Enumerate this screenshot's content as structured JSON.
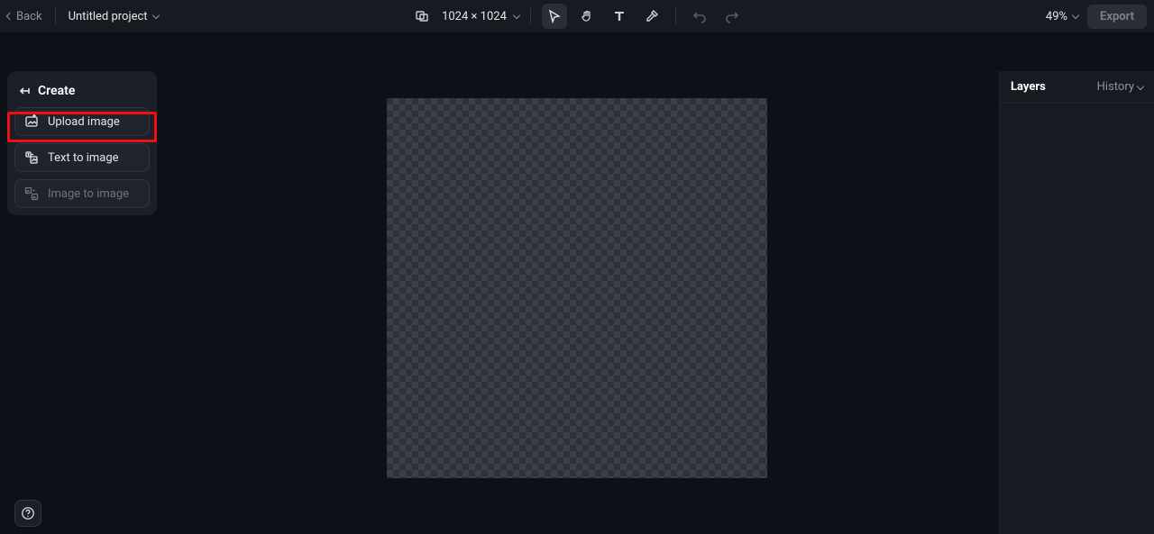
{
  "topbar": {
    "back_label": "Back",
    "project_title": "Untitled project",
    "dimensions": "1024 × 1024",
    "zoom_label": "49%",
    "export_label": "Export"
  },
  "tools": {
    "select": "select",
    "pan": "pan",
    "text": "text",
    "eyedropper": "eyedropper",
    "undo": "undo",
    "redo": "redo",
    "dims_icon": "dimensions"
  },
  "create_panel": {
    "title": "Create",
    "upload_label": "Upload image",
    "text_to_image_label": "Text to image",
    "image_to_image_label": "Image to image"
  },
  "layers_panel": {
    "title": "Layers",
    "history_label": "History"
  },
  "help": {
    "glyph": "?"
  }
}
